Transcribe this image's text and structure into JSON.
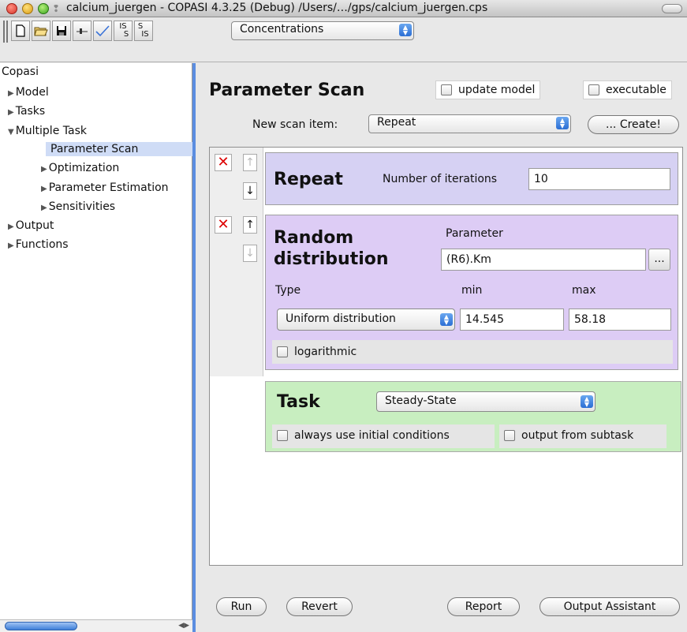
{
  "window": {
    "title": "calcium_juergen - COPASI 4.3.25 (Debug) /Users/…/gps/calcium_juergen.cps"
  },
  "toolbar": {
    "buttons": [
      "new-document",
      "open-folder",
      "save",
      "slider",
      "check",
      "IS to S",
      "S to IS"
    ],
    "is_s_label_top": "IS",
    "is_s_label_bottom": "S",
    "s_is_label_top": "S",
    "s_is_label_bottom": "IS",
    "units_combo": "Concentrations"
  },
  "sidebar": {
    "root": "Copasi",
    "items": [
      {
        "label": "Model",
        "expanded": false
      },
      {
        "label": "Tasks",
        "expanded": false
      },
      {
        "label": "Multiple Task",
        "expanded": true
      },
      {
        "label": "Parameter Scan",
        "selected": true
      },
      {
        "label": "Optimization",
        "expanded": false
      },
      {
        "label": "Parameter Estimation",
        "expanded": false
      },
      {
        "label": "Sensitivities",
        "expanded": false
      },
      {
        "label": "Output",
        "expanded": false
      },
      {
        "label": "Functions",
        "expanded": false
      }
    ]
  },
  "main": {
    "title": "Parameter Scan",
    "update_model_label": "update model",
    "executable_label": "executable",
    "new_scan_label": "New scan item:",
    "new_scan_value": "Repeat",
    "create_label": "... Create!",
    "repeat": {
      "title": "Repeat",
      "iterations_label": "Number of iterations",
      "iterations_value": "10"
    },
    "random": {
      "title_line1": "Random",
      "title_line2": "distribution",
      "parameter_label": "Parameter",
      "parameter_value": "(R6).Km",
      "browse_label": "...",
      "type_label": "Type",
      "min_label": "min",
      "max_label": "max",
      "type_value": "Uniform distribution",
      "min_value": "14.545",
      "max_value": "58.18",
      "log_label": "logarithmic"
    },
    "task": {
      "title": "Task",
      "task_value": "Steady-State",
      "initial_label": "always use initial conditions",
      "subtask_label": "output from subtask"
    },
    "buttons": {
      "run": "Run",
      "revert": "Revert",
      "report": "Report",
      "output_assistant": "Output Assistant"
    }
  }
}
